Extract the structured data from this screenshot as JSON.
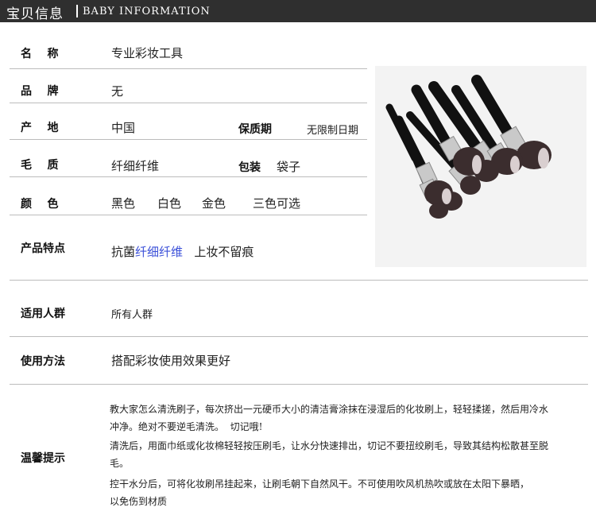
{
  "header": {
    "title_cn": "宝贝信息",
    "title_en": "BABY INFORMATION"
  },
  "rows": {
    "name": {
      "label": "名    称",
      "value": "专业彩妆工具"
    },
    "brand": {
      "label": "品    牌",
      "value": "无"
    },
    "origin": {
      "label": "产    地",
      "value": "中国",
      "extra_label": "保质期",
      "extra_value": "无限制日期"
    },
    "material": {
      "label": "毛    质",
      "value": "纤细纤维",
      "extra_label": "包装",
      "extra_value": "袋子"
    },
    "color": {
      "label": "颜    色",
      "values": [
        "黑色",
        "白色",
        "金色",
        "三色可选"
      ]
    },
    "features": {
      "label": "产品特点",
      "part1": "抗菌",
      "part2": "纤细纤维",
      "part3": "上妆不留痕"
    },
    "audience": {
      "label": "适用人群",
      "value": "所有人群"
    },
    "usage": {
      "label": "使用方法",
      "value": "搭配彩妆使用效果更好"
    },
    "tips": {
      "label": "温馨提示",
      "lines": [
        "教大家怎么清洗刷子，每次挤出一元硬币大小的清洁膏涂抹在浸湿后的化妆刷上，轻轻揉搓，然后用冷水",
        "冲净。绝对不要逆毛清洗。  切记哦!",
        "清洗后，用面巾纸或化妆棉轻轻按压刷毛，让水分快速排出，切记不要扭绞刷毛，导致其结构松散甚至脱",
        "毛。",
        "控干水分后，可将化妆刷吊挂起来，让刷毛朝下自然风干。不可使用吹风机热吹或放在太阳下暴晒，",
        "以免伤到材质"
      ]
    }
  },
  "image": {
    "icon": "makeup-brush-set-photo"
  }
}
